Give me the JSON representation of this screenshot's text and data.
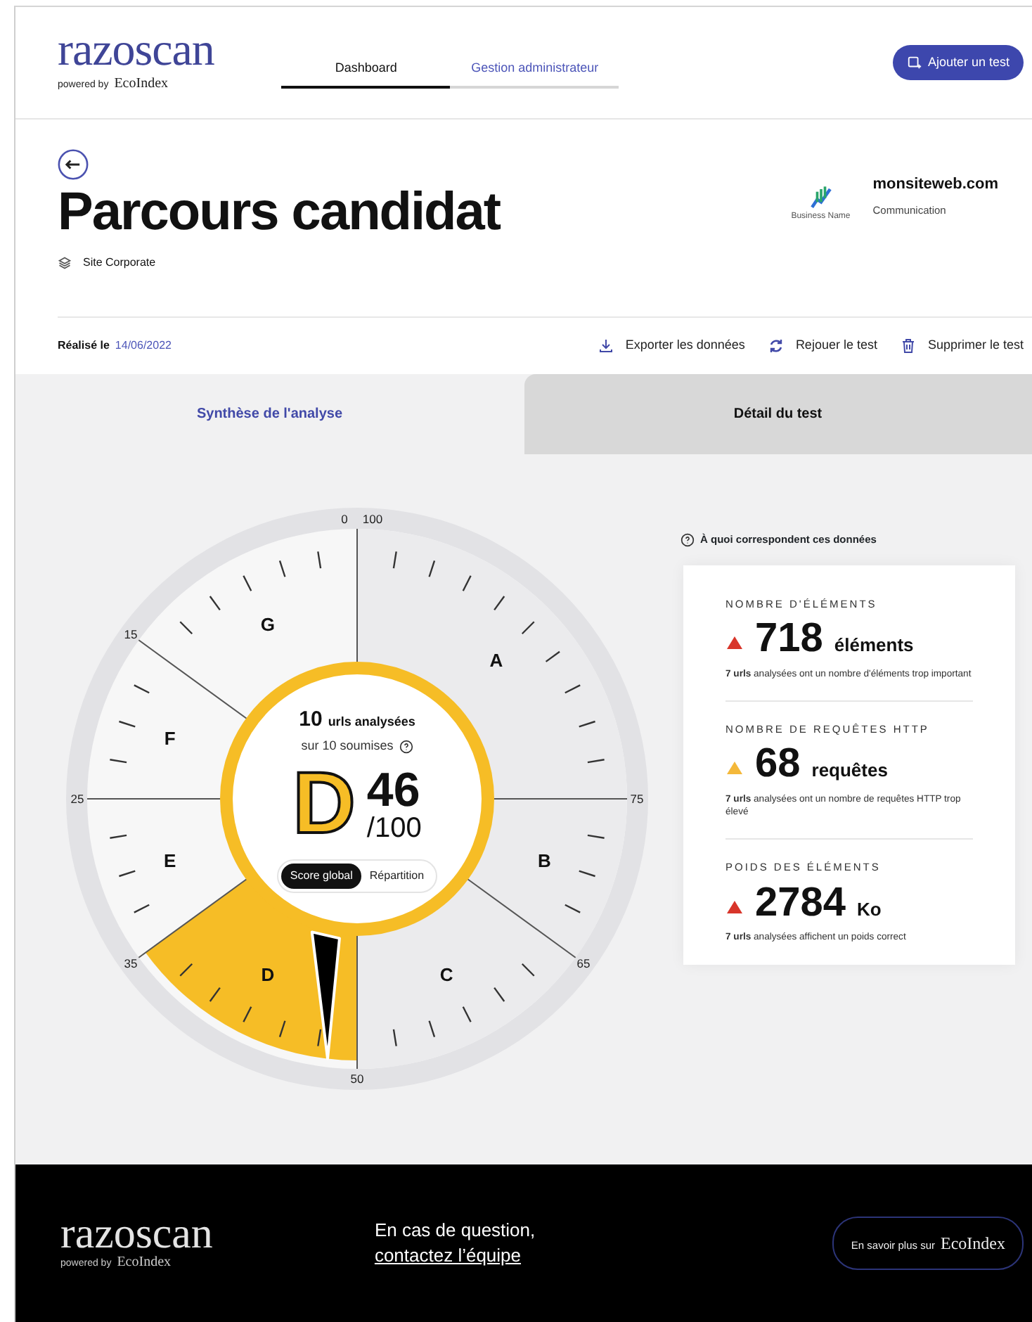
{
  "header": {
    "logo": {
      "name": "razoscan",
      "tagline": "powered by",
      "brand": "EcoIndex"
    },
    "nav": [
      {
        "label": "Dashboard",
        "selected": true
      },
      {
        "label": "Gestion administrateur",
        "selected": false
      }
    ],
    "add_button": "Ajouter un test"
  },
  "title": "Parcours candidat",
  "category": "Site Corporate",
  "site": {
    "name": "monsiteweb.com",
    "sector": "Communication",
    "logo_caption": "Business Name"
  },
  "date_label": "Réalisé le",
  "date": "14/06/2022",
  "actions": [
    {
      "kind": "export",
      "label": "Exporter les données"
    },
    {
      "kind": "replay",
      "label": "Rejouer le test"
    },
    {
      "kind": "delete",
      "label": "Supprimer le test"
    }
  ],
  "tabs": [
    {
      "label": "Synthèse de l'analyse",
      "selected": true
    },
    {
      "label": "Détail du test",
      "selected": false
    }
  ],
  "gauge": {
    "scale_labels": [
      "0",
      "100",
      "15",
      "25",
      "35",
      "50",
      "65",
      "75"
    ],
    "grades": [
      {
        "letter": "G",
        "selected": false
      },
      {
        "letter": "F",
        "selected": false
      },
      {
        "letter": "E",
        "selected": false
      },
      {
        "letter": "D",
        "selected": true
      },
      {
        "letter": "C",
        "selected": false
      },
      {
        "letter": "B",
        "selected": false
      },
      {
        "letter": "A",
        "selected": false
      }
    ],
    "count": "10",
    "count_label": "urls analysées",
    "submitted": "sur 10 soumises",
    "grade": "D",
    "score": "46",
    "max": "/100",
    "toggle": [
      {
        "label": "Score global",
        "selected": true
      },
      {
        "label": "Répartition",
        "selected": false
      }
    ]
  },
  "help_link": "À quoi correspondent ces données",
  "metrics": [
    {
      "title": "NOMBRE D'ÉLÉMENTS",
      "color": "#d8352a",
      "value": "718",
      "unit": "éléments",
      "note": "**7 urls** analysées ont un nombre d'éléments trop important"
    },
    {
      "title": "NOMBRE DE REQUÊTES HTTP",
      "color": "#f4b83a",
      "value": "68",
      "unit": "requêtes",
      "note": "**7 urls** analysées ont un nombre de requêtes HTTP trop élevé"
    },
    {
      "title": "POIDS DES ÉLÉMENTS",
      "color": "#d8352a",
      "value": "2784",
      "unit": "Ko",
      "note": "**7 urls** analysées affichent un poids correct"
    }
  ],
  "footer": {
    "logo": {
      "name": "razoscan",
      "tagline": "powered by",
      "brand": "EcoIndex"
    },
    "question": "En cas de question,",
    "contact": "contactez l’équipe",
    "button": {
      "label": "En savoir plus sur",
      "brand": "EcoIndex"
    }
  }
}
